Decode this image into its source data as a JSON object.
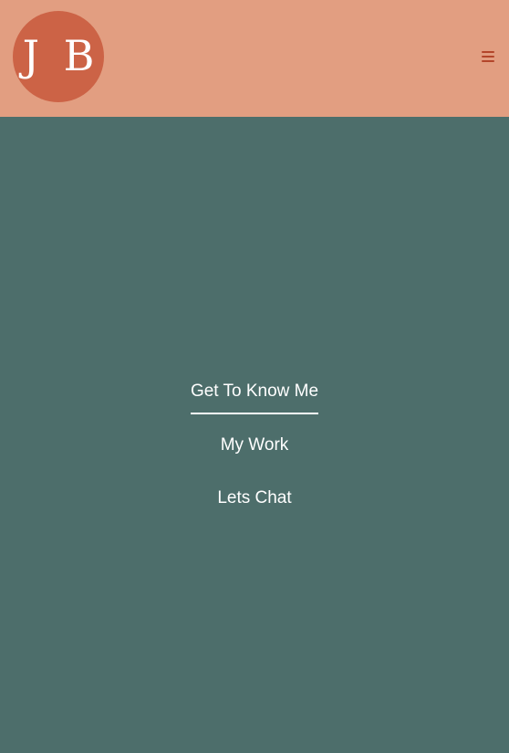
{
  "header": {
    "logo_text": "J B",
    "menu_icon": "hamburger-menu-icon",
    "colors": {
      "header_background": "#e29e81",
      "logo_background": "#cc6346",
      "menu_icon": "#b3452a"
    }
  },
  "nav": {
    "items": [
      {
        "label": "Get To Know Me",
        "active": true
      },
      {
        "label": "My Work",
        "active": false
      },
      {
        "label": "Lets Chat",
        "active": false
      }
    ],
    "colors": {
      "background": "#4d6e6b",
      "text": "#ffffff"
    }
  }
}
